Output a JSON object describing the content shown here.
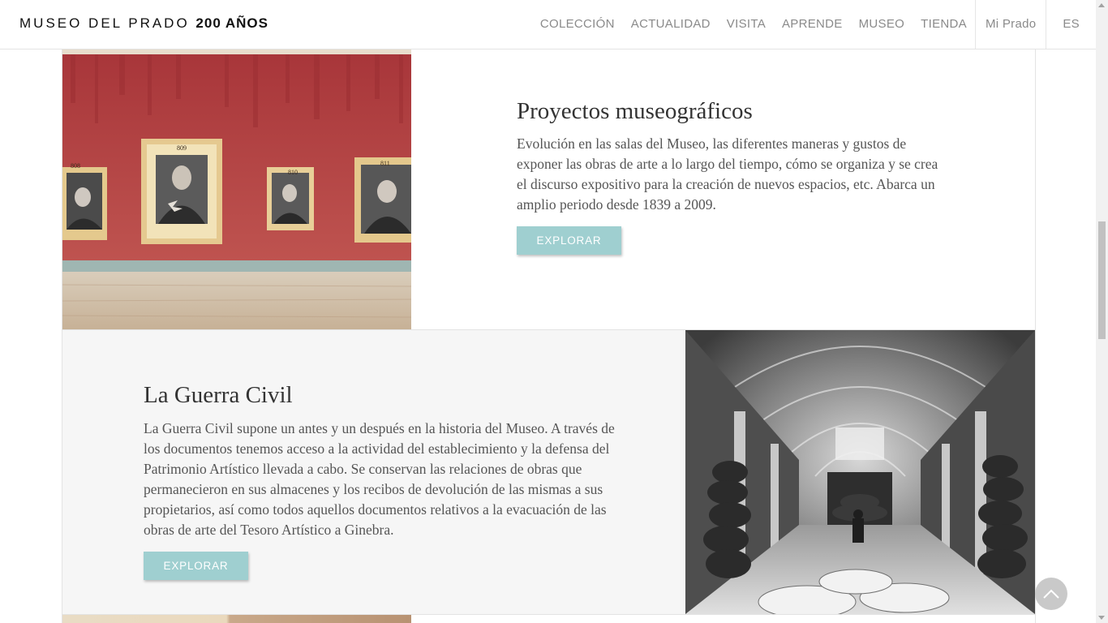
{
  "header": {
    "logo_main": "MUSEO DEL PRADO",
    "logo_bold": "200 AÑOS",
    "nav": [
      "COLECCIÓN",
      "ACTUALIDAD",
      "VISITA",
      "APRENDE",
      "MUSEO",
      "TIENDA"
    ],
    "mi_prado": "Mi Prado",
    "language": "ES"
  },
  "sections": [
    {
      "title": "Proyectos museográficos",
      "description": "Evolución en las salas del Museo, las diferentes maneras y gustos de exponer las obras de arte a lo largo del tiempo, cómo se organiza y se crea el discurso expositivo para la creación de nuevos espacios, etc. Abarca un amplio periodo desde 1839 a 2009.",
      "button": "EXPLORAR"
    },
    {
      "title": "La Guerra Civil",
      "description": "La Guerra Civil supone un antes y un después en la historia del Museo. A través de los documentos tenemos acceso a la actividad del establecimiento y la defensa del Patrimonio Artístico llevada a cabo. Se conservan las relaciones de obras que permanecieron en sus almacenes y los recibos de devolución de las mismas a sus propietarios, así como todos aquellos documentos relativos a la evacuación de las obras de arte del Tesoro Artístico a Ginebra.",
      "button": "EXPLORAR"
    }
  ],
  "image_labels": [
    "808",
    "809",
    "810",
    "811"
  ],
  "colors": {
    "accent_button": "#9fcfd0",
    "wall_red": "#b3433f",
    "panel_gray": "#f6f6f6"
  },
  "icons": {
    "back_to_top": "chevron-up-icon"
  }
}
